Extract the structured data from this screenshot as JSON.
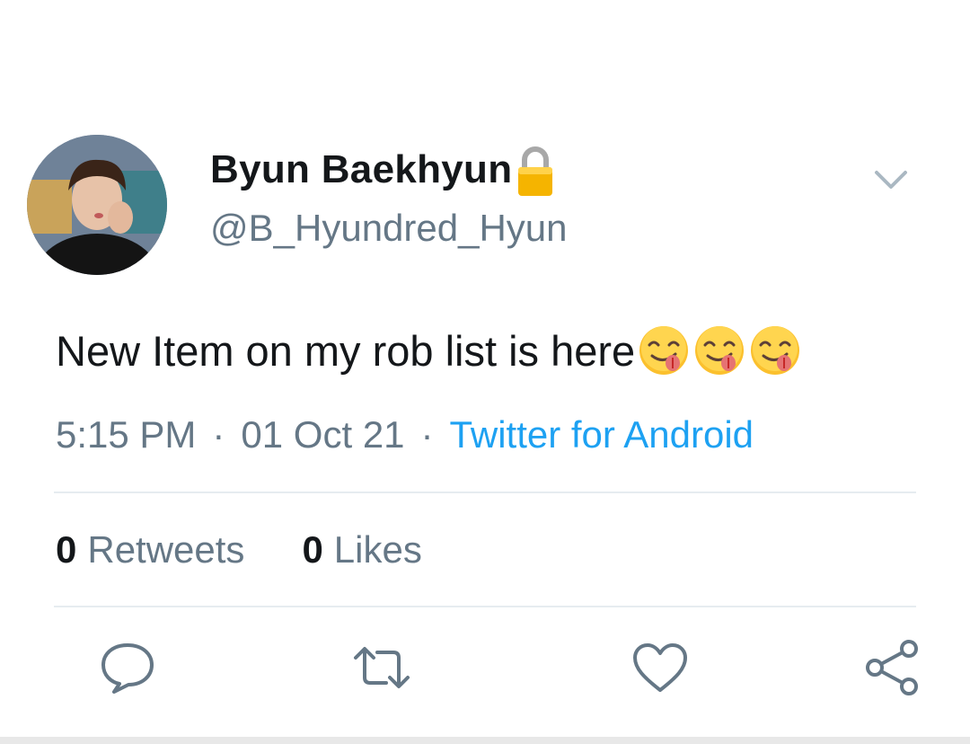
{
  "tweet": {
    "display_name": "Byun Baekhyun",
    "handle": "@B_Hyundred_Hyun",
    "text": "New Item on my rob list is here",
    "emoji_count": 3,
    "time": "5:15 PM",
    "date": "01 Oct 21",
    "separator": "·",
    "source": "Twitter for Android"
  },
  "stats": {
    "retweets_count": "0",
    "retweets_label": "Retweets",
    "likes_count": "0",
    "likes_label": "Likes"
  },
  "icons": {
    "lock": "lock-icon",
    "chevron": "chevron-down-icon",
    "reply": "reply-icon",
    "retweet": "retweet-icon",
    "like": "heart-icon",
    "share": "share-icon",
    "emoji": "face-savoring-food-emoji"
  },
  "colors": {
    "text": "#14171a",
    "secondary": "#657786",
    "link": "#1da1f2",
    "divider": "#e6ecf0"
  }
}
